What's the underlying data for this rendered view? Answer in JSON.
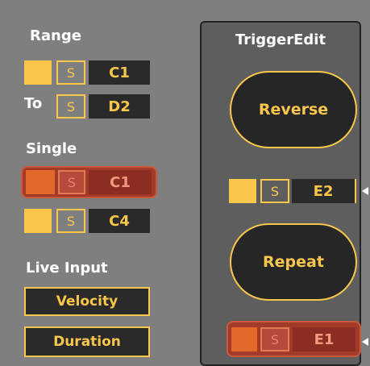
{
  "left": {
    "range_label": "Range",
    "range_s": "S",
    "range_note": "C1",
    "to_label": "To",
    "to_s": "S",
    "to_note": "D2",
    "single_label": "Single",
    "single_hl_s": "S",
    "single_hl_note": "C1",
    "single_s": "S",
    "single_note": "C4",
    "live_input_label": "Live Input",
    "velocity_label": "Velocity",
    "duration_label": "Duration"
  },
  "trigger_edit": {
    "tab_label": "TriggerEdit",
    "reverse_label": "Reverse",
    "mid_s": "S",
    "mid_note": "E2",
    "repeat_label": "Repeat",
    "bottom_s": "S",
    "bottom_note": "E1"
  },
  "colors": {
    "accent": "#fbc74b",
    "highlight": "#a33a2a",
    "background": "#7f7f7f",
    "panel": "#5e5e5e",
    "dark": "#2a2a2a"
  }
}
